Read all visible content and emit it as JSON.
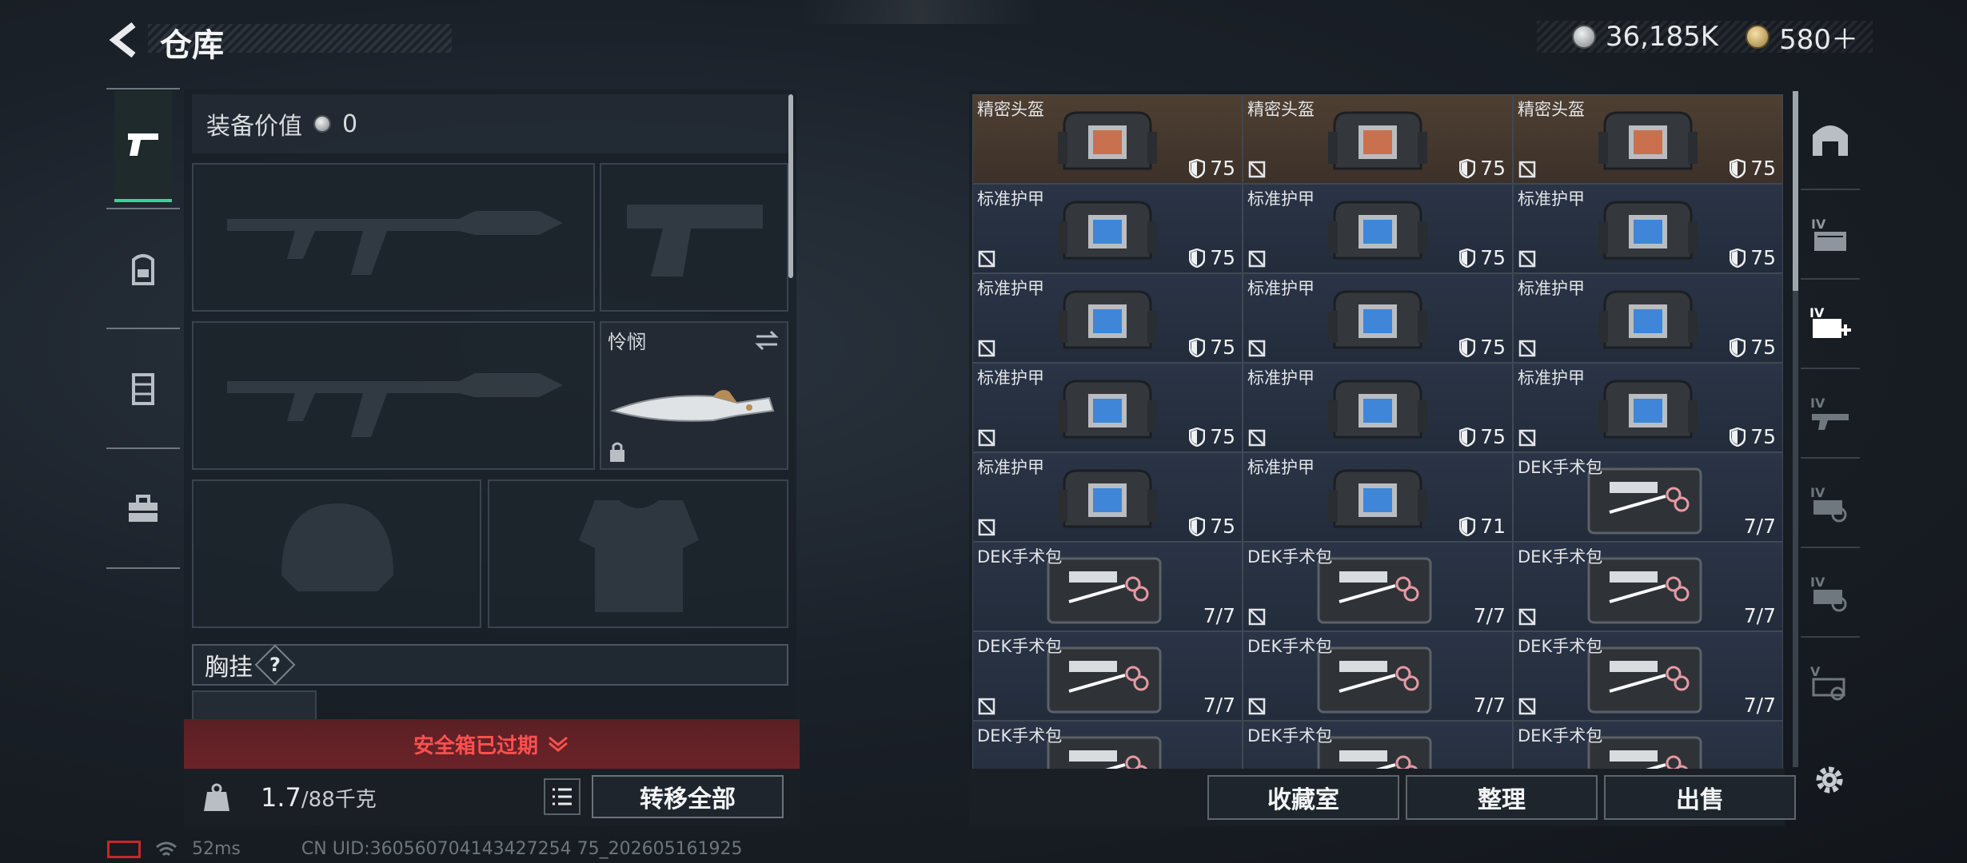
{
  "header": {
    "title": "仓库",
    "silver": "36,185K",
    "gold": "580＋"
  },
  "equipment": {
    "value_label": "装备价值",
    "value": "0",
    "melee_name": "怜悯",
    "chest_label": "胸挂",
    "chest_help": "?",
    "expired_text": "安全箱已过期",
    "weight_current": "1.7",
    "weight_max": "/88千克",
    "transfer_all": "转移全部"
  },
  "status": {
    "ping": "52ms",
    "uid": "CN UID:360560704143427254 75_202605161925"
  },
  "grid": {
    "items": [
      {
        "name": "精密头盔",
        "value": "75",
        "kind": "helmet",
        "flag": false
      },
      {
        "name": "精密头盔",
        "value": "75",
        "kind": "helmet",
        "flag": true
      },
      {
        "name": "精密头盔",
        "value": "75",
        "kind": "helmet",
        "flag": true
      },
      {
        "name": "标准护甲",
        "value": "75",
        "kind": "armor",
        "flag": true
      },
      {
        "name": "标准护甲",
        "value": "75",
        "kind": "armor",
        "flag": true
      },
      {
        "name": "标准护甲",
        "value": "75",
        "kind": "armor",
        "flag": true
      },
      {
        "name": "标准护甲",
        "value": "75",
        "kind": "armor",
        "flag": true
      },
      {
        "name": "标准护甲",
        "value": "75",
        "kind": "armor",
        "flag": true
      },
      {
        "name": "标准护甲",
        "value": "75",
        "kind": "armor",
        "flag": true
      },
      {
        "name": "标准护甲",
        "value": "75",
        "kind": "armor",
        "flag": true
      },
      {
        "name": "标准护甲",
        "value": "75",
        "kind": "armor",
        "flag": true
      },
      {
        "name": "标准护甲",
        "value": "75",
        "kind": "armor",
        "flag": true
      },
      {
        "name": "标准护甲",
        "value": "75",
        "kind": "armor",
        "flag": true
      },
      {
        "name": "标准护甲",
        "value": "71",
        "kind": "armor",
        "flag": false
      },
      {
        "name": "DEK手术包",
        "value": "7/7",
        "kind": "med",
        "flag": false
      },
      {
        "name": "DEK手术包",
        "value": "7/7",
        "kind": "med",
        "flag": false
      },
      {
        "name": "DEK手术包",
        "value": "7/7",
        "kind": "med",
        "flag": true
      },
      {
        "name": "DEK手术包",
        "value": "7/7",
        "kind": "med",
        "flag": true
      },
      {
        "name": "DEK手术包",
        "value": "7/7",
        "kind": "med",
        "flag": true
      },
      {
        "name": "DEK手术包",
        "value": "7/7",
        "kind": "med",
        "flag": true
      },
      {
        "name": "DEK手术包",
        "value": "7/7",
        "kind": "med",
        "flag": true
      },
      {
        "name": "DEK手术包",
        "value": "",
        "kind": "med",
        "flag": false
      },
      {
        "name": "DEK手术包",
        "value": "",
        "kind": "med",
        "flag": false
      },
      {
        "name": "DEK手术包",
        "value": "",
        "kind": "med",
        "flag": false
      }
    ],
    "buttons": {
      "collection": "收藏室",
      "sort": "整理",
      "sell": "出售"
    }
  },
  "icons": {
    "left_tabs": [
      "pistol-icon",
      "backpack-icon",
      "vest-icon",
      "toolbox-icon"
    ],
    "right_tabs": [
      "vault-icon",
      "storage-iv-icon",
      "med-iv-icon",
      "gun-iv-icon",
      "hand-iv-icon",
      "hand-iv-icon-2",
      "scope-v-icon"
    ]
  },
  "colors": {
    "accent": "#36d49a",
    "danger": "#ff4f4f",
    "gold_cell": "#4e3f32",
    "blue_cell": "#2a3446"
  }
}
